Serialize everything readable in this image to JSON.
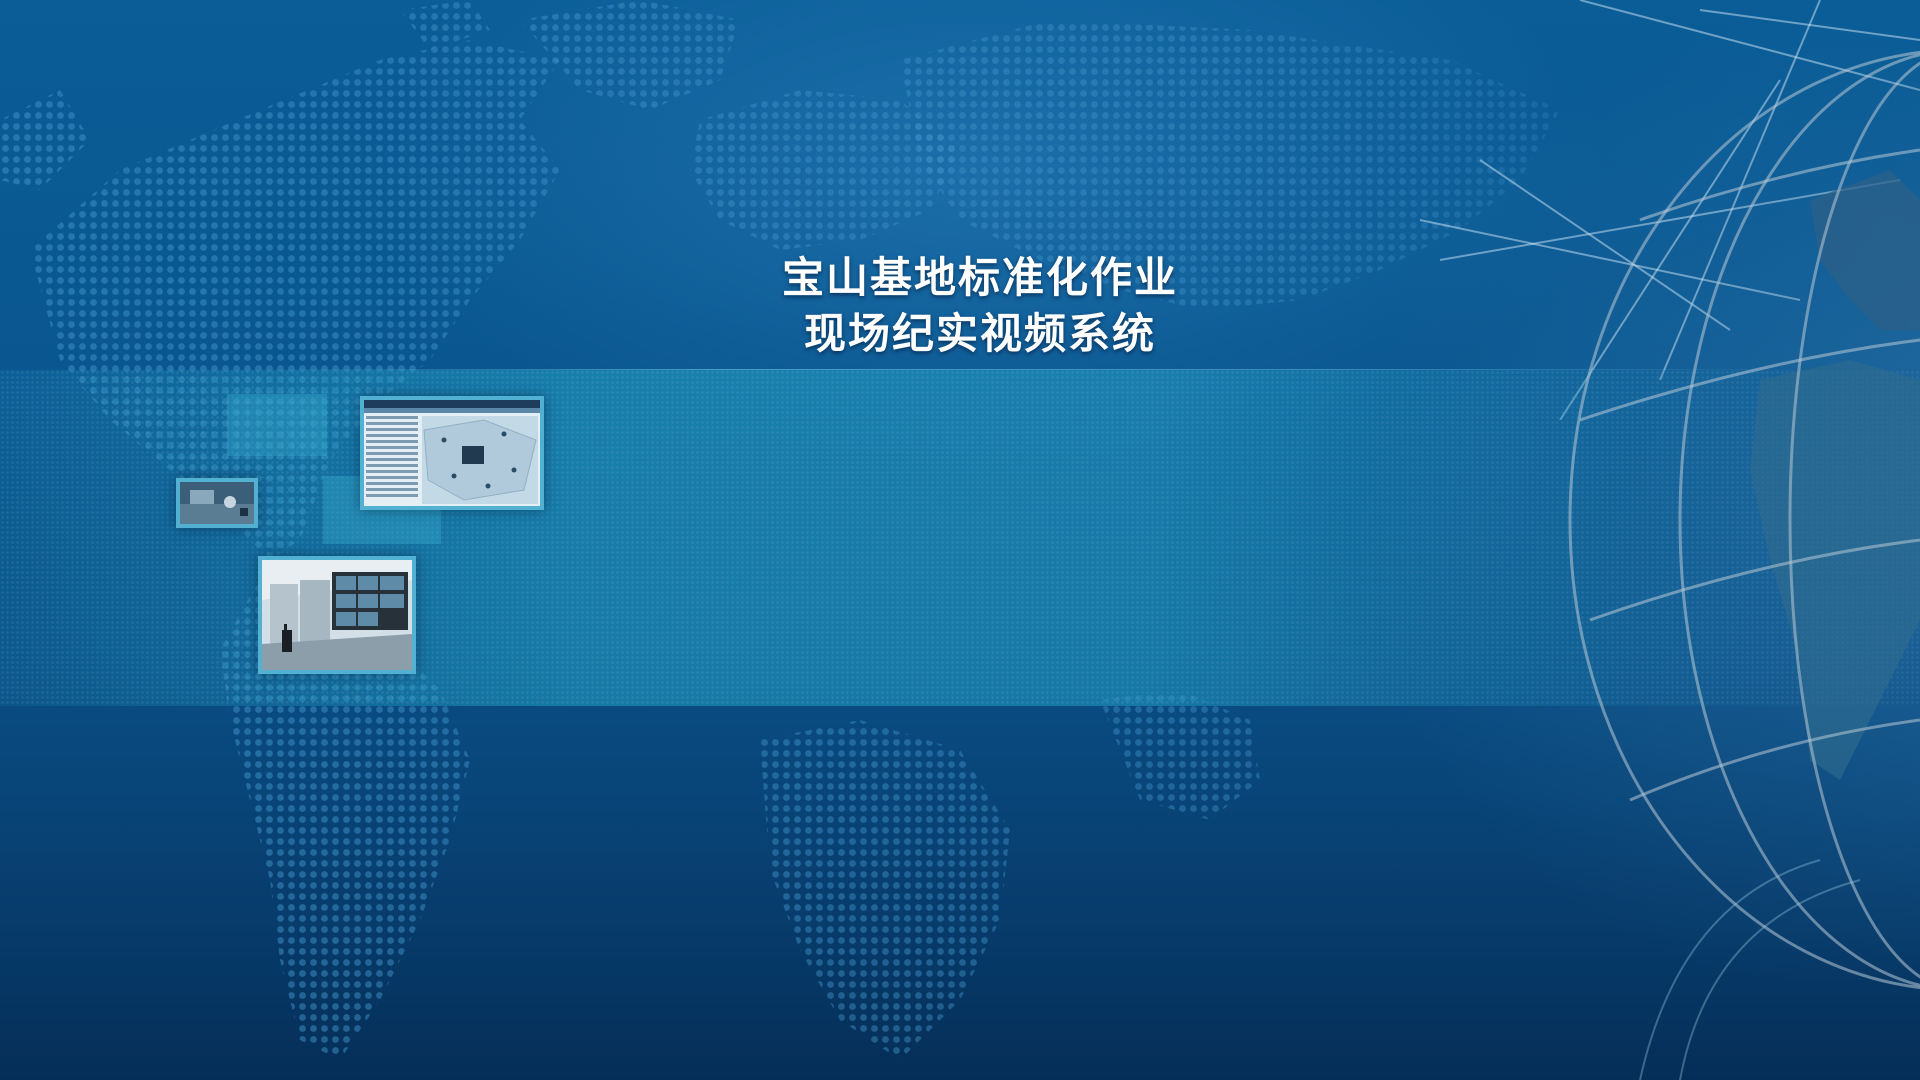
{
  "title": {
    "line1": "宝山基地标准化作业",
    "line2": "现场纪实视频系统"
  },
  "colors": {
    "background_top": "#0a5d97",
    "background_bottom": "#052e57",
    "band": "#239bc3",
    "title_text": "#ffffff"
  },
  "decorations": {
    "thumbnails": [
      "software-screenshot-thumbnail",
      "surveillance-camera-thumbnail",
      "control-room-thumbnail"
    ],
    "background": [
      "dotted-world-map",
      "globe-wireframe",
      "light-streaks"
    ]
  }
}
